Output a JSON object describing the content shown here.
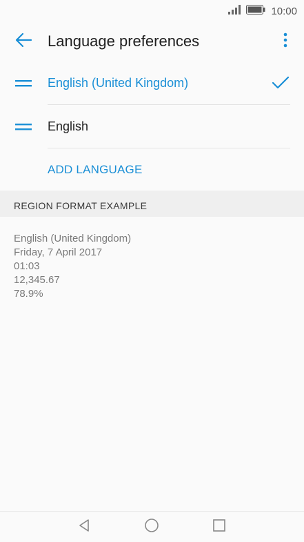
{
  "status": {
    "time": "10:00"
  },
  "header": {
    "title": "Language preferences"
  },
  "languages": [
    {
      "label": "English (United Kingdom)",
      "selected": true
    },
    {
      "label": "English",
      "selected": false
    }
  ],
  "add_language_label": "ADD LANGUAGE",
  "region": {
    "header": "REGION FORMAT EXAMPLE",
    "examples": [
      "English (United Kingdom)",
      "Friday, 7 April 2017",
      "01:03",
      "12,345.67",
      "78.9%"
    ]
  },
  "colors": {
    "accent": "#1a8fd6",
    "background": "#fafafa",
    "section_bg": "#efefef"
  },
  "icons": {
    "back": "arrow-left-icon",
    "more": "more-vertical-icon",
    "drag": "drag-handle-icon",
    "check": "check-icon",
    "nav_back": "triangle-back-icon",
    "nav_home": "circle-home-icon",
    "nav_recents": "square-recents-icon"
  }
}
